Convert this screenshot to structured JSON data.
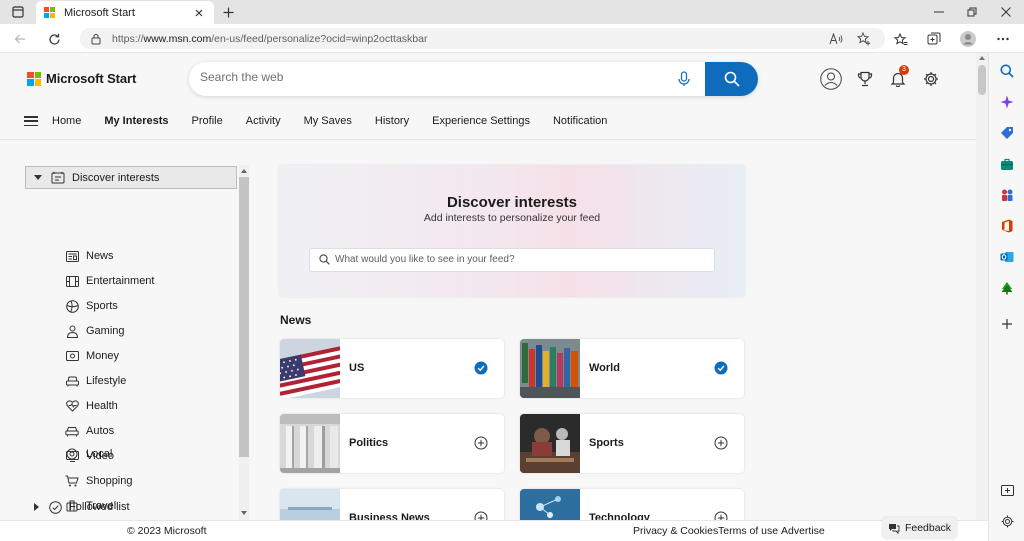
{
  "browser": {
    "tab_title": "Microsoft Start",
    "url_prefix": "https://",
    "url_host": "www.msn.com",
    "url_path": "/en-us/feed/personalize?ocid=winp2octtaskbar"
  },
  "header": {
    "brand": "Microsoft Start",
    "search_placeholder": "Search the web",
    "notification_count": "3",
    "brand_colors": [
      "#f25022",
      "#7fba00",
      "#00a4ef",
      "#ffb900"
    ],
    "accent": "#0f6cbd"
  },
  "nav": {
    "items": [
      "Home",
      "My Interests",
      "Profile",
      "Activity",
      "My Saves",
      "History",
      "Experience Settings",
      "Notification"
    ],
    "active": "My Interests"
  },
  "tree": {
    "header": "Discover interests",
    "items": [
      {
        "label": "News",
        "icon": "newspaper-icon"
      },
      {
        "label": "Entertainment",
        "icon": "film-icon"
      },
      {
        "label": "Sports",
        "icon": "ball-icon"
      },
      {
        "label": "Gaming",
        "icon": "controller-icon"
      },
      {
        "label": "Money",
        "icon": "money-icon"
      },
      {
        "label": "Lifestyle",
        "icon": "couch-icon"
      },
      {
        "label": "Health",
        "icon": "heart-icon"
      },
      {
        "label": "Autos",
        "icon": "car-icon"
      },
      {
        "label": "Video",
        "icon": "video-icon"
      },
      {
        "label": "Shopping",
        "icon": "cart-icon"
      },
      {
        "label": "Travel",
        "icon": "luggage-icon"
      },
      {
        "label": "Local",
        "icon": "location-pin-icon"
      }
    ],
    "footer": "Followed list"
  },
  "discover": {
    "title": "Discover interests",
    "subtitle": "Add interests to personalize your feed",
    "placeholder": "What would you like to see in your feed?"
  },
  "news": {
    "title": "News",
    "topics": [
      {
        "label": "US",
        "followed": true
      },
      {
        "label": "World",
        "followed": true
      },
      {
        "label": "Politics",
        "followed": false
      },
      {
        "label": "Sports",
        "followed": false
      },
      {
        "label": "Business News",
        "followed": false
      },
      {
        "label": "Technology",
        "followed": false
      }
    ]
  },
  "footer": {
    "copyright": "© 2023 Microsoft",
    "links": [
      "Privacy & Cookies",
      "Terms of use",
      "Advertise"
    ],
    "feedback": "Feedback"
  }
}
